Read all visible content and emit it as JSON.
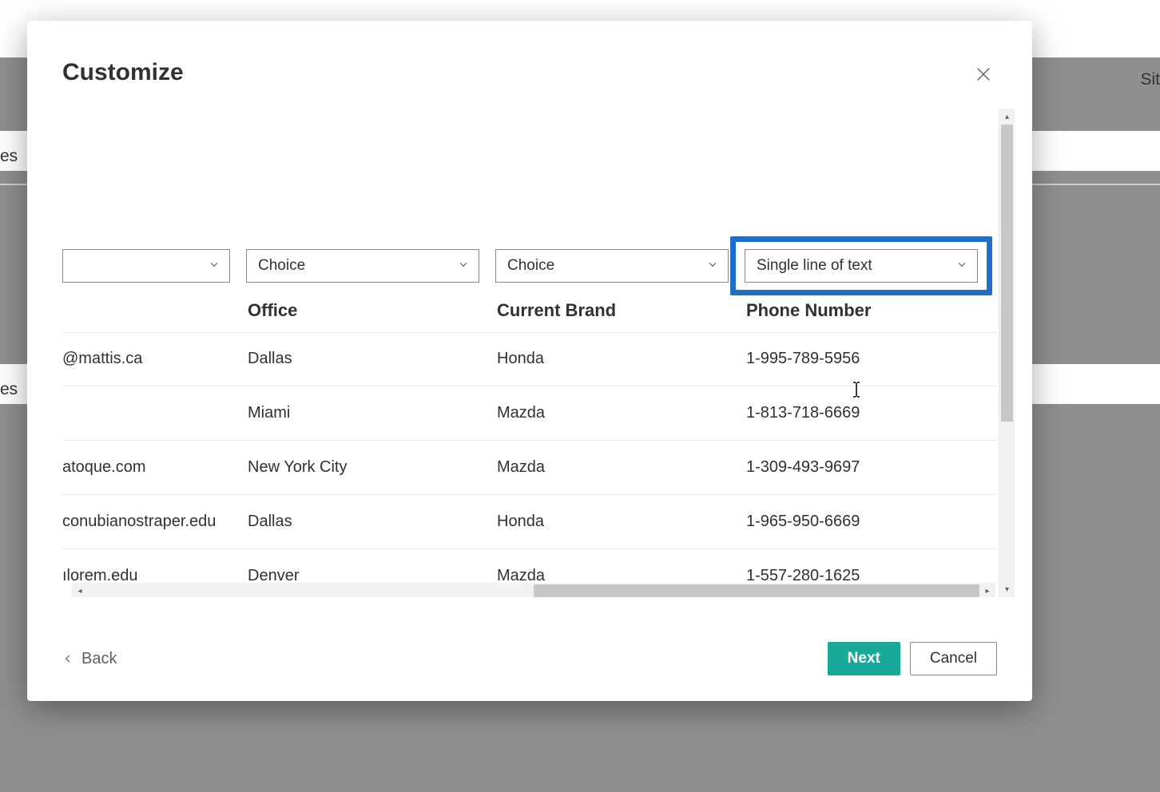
{
  "background": {
    "right_text": "Sit",
    "left_text1": "es",
    "left_text2": "es"
  },
  "modal": {
    "title": "Customize",
    "dropdowns": {
      "one": "",
      "two": "Choice",
      "three": "Choice",
      "four": "Single line of text"
    },
    "headers": {
      "email": "",
      "office": "Office",
      "brand": "Current Brand",
      "phone": "Phone Number"
    },
    "rows": [
      {
        "email": "@mattis.ca",
        "office": "Dallas",
        "brand": "Honda",
        "phone": "1-995-789-5956"
      },
      {
        "email": "",
        "office": "Miami",
        "brand": "Mazda",
        "phone": "1-813-718-6669"
      },
      {
        "email": "atoque.com",
        "office": "New York City",
        "brand": "Mazda",
        "phone": "1-309-493-9697"
      },
      {
        "email": "conubianostraper.edu",
        "office": "Dallas",
        "brand": "Honda",
        "phone": "1-965-950-6669"
      },
      {
        "email": "ılorem.edu",
        "office": "Denver",
        "brand": "Mazda",
        "phone": "1-557-280-1625"
      }
    ],
    "footer": {
      "back": "Back",
      "next": "Next",
      "cancel": "Cancel"
    }
  }
}
